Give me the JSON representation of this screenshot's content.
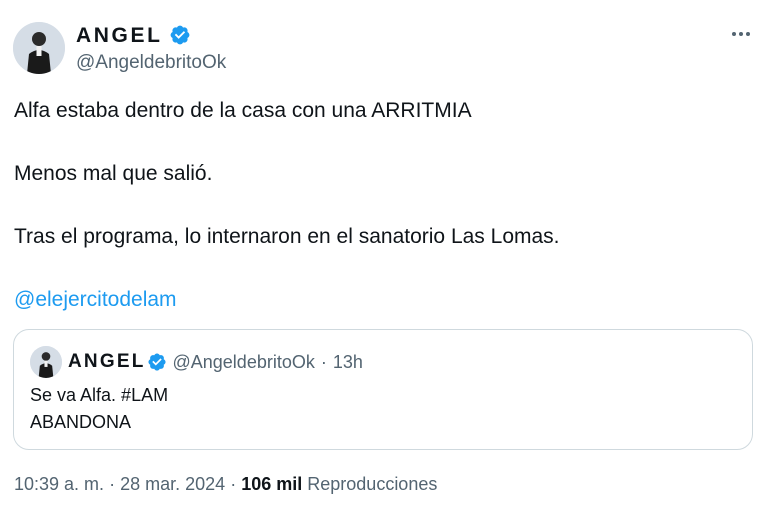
{
  "tweet": {
    "author": {
      "display_name": "ANGEL",
      "handle": "@AngeldebritoOk",
      "verified": true,
      "avatar_icon": "profile-photo"
    },
    "more_icon": "more-options-icon",
    "lines": [
      "Alfa estaba dentro de la casa con una ARRITMIA",
      "Menos mal que salió.",
      "Tras el programa, lo internaron en el sanatorio Las Lomas."
    ],
    "mention": "@elejercitodelam",
    "quoted": {
      "display_name": "ANGEL",
      "handle": "@AngeldebritoOk",
      "separator": "·",
      "time": "13h",
      "lines": [
        "Se va Alfa. #LAM",
        "ABANDONA"
      ]
    },
    "meta": {
      "time": "10:39 a. m.",
      "separator1": "·",
      "date": "28 mar. 2024",
      "separator2": "·",
      "views_count": "106 mil",
      "views_label": "Reproducciones"
    }
  },
  "colors": {
    "accent": "#1d9bf0",
    "text_primary": "#0f1419",
    "text_secondary": "#536471",
    "border": "#cfd9de"
  }
}
